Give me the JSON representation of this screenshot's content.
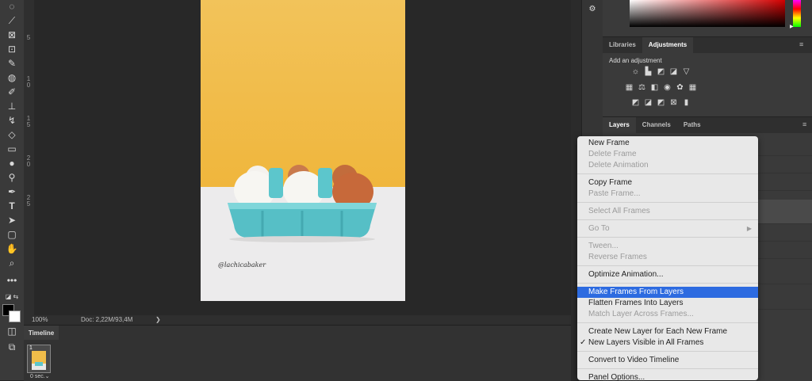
{
  "status": {
    "zoom": "100%",
    "doc": "Doc: 2,22M/93,4M",
    "arrow": "❯"
  },
  "ruler": {
    "marks": [
      "5",
      "1\n0",
      "1\n5",
      "2\n0",
      "2\n5"
    ]
  },
  "timeline": {
    "tab_label": "Timeline",
    "frame_number": "1",
    "frame_delay": "0 sec.⌄"
  },
  "watermark": "@lachicabaker",
  "panels": {
    "libraries_tab": "Libraries",
    "adjustments_tab": "Adjustments",
    "add_adjustment": "Add an adjustment",
    "layers_tab": "Layers",
    "channels_tab": "Channels",
    "paths_tab": "Paths"
  },
  "menu": {
    "items": [
      {
        "label": "New Frame",
        "enabled": true
      },
      {
        "label": "Delete Frame",
        "enabled": false
      },
      {
        "label": "Delete Animation",
        "enabled": false
      },
      {
        "label": "Copy Frame",
        "enabled": true
      },
      {
        "label": "Paste Frame...",
        "enabled": false
      },
      {
        "label": "Select All Frames",
        "enabled": false
      },
      {
        "label": "Go To",
        "enabled": false,
        "submenu": "▶"
      },
      {
        "label": "Tween...",
        "enabled": false
      },
      {
        "label": "Reverse Frames",
        "enabled": false
      },
      {
        "label": "Optimize Animation...",
        "enabled": true
      },
      {
        "label": "Make Frames From Layers",
        "enabled": true,
        "highlighted": true
      },
      {
        "label": "Flatten Frames Into Layers",
        "enabled": true
      },
      {
        "label": "Match Layer Across Frames...",
        "enabled": false
      },
      {
        "label": "Create New Layer for Each New Frame",
        "enabled": true
      },
      {
        "label": "New Layers Visible in All Frames",
        "enabled": true,
        "checked": true
      },
      {
        "label": "Convert to Video Timeline",
        "enabled": true
      },
      {
        "label": "Panel Options...",
        "enabled": true
      }
    ],
    "checkmark": "✓"
  },
  "colors": {
    "accent": "#2d6be0",
    "photo_wall": "#f2c14e",
    "carton": "#5cc6cc"
  }
}
